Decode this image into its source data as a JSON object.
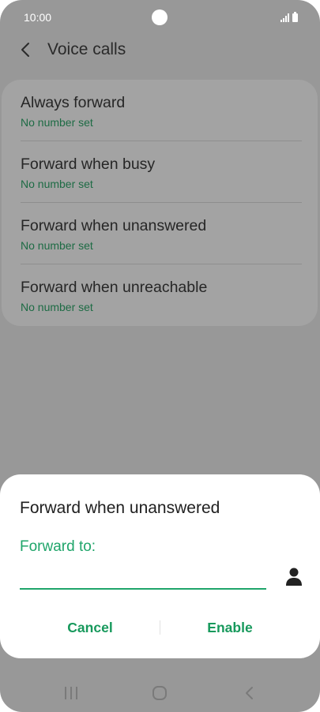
{
  "status_bar": {
    "time": "10:00"
  },
  "header": {
    "title": "Voice calls"
  },
  "forward_options": [
    {
      "title": "Always forward",
      "subtitle": "No number set"
    },
    {
      "title": "Forward when busy",
      "subtitle": "No number set"
    },
    {
      "title": "Forward when unanswered",
      "subtitle": "No number set"
    },
    {
      "title": "Forward when unreachable",
      "subtitle": "No number set"
    }
  ],
  "dialog": {
    "title": "Forward when unanswered",
    "field_label": "Forward to:",
    "input_value": "",
    "cancel_label": "Cancel",
    "enable_label": "Enable"
  },
  "icons": {
    "back": "back-arrow-icon",
    "contact": "contact-person-icon",
    "nav_recents": "recents-icon",
    "nav_home": "home-icon",
    "nav_back": "nav-back-icon"
  },
  "colors": {
    "accent": "#1fa56a",
    "dimmed_background": "#989898",
    "subtitle_green": "#1d6b44"
  }
}
